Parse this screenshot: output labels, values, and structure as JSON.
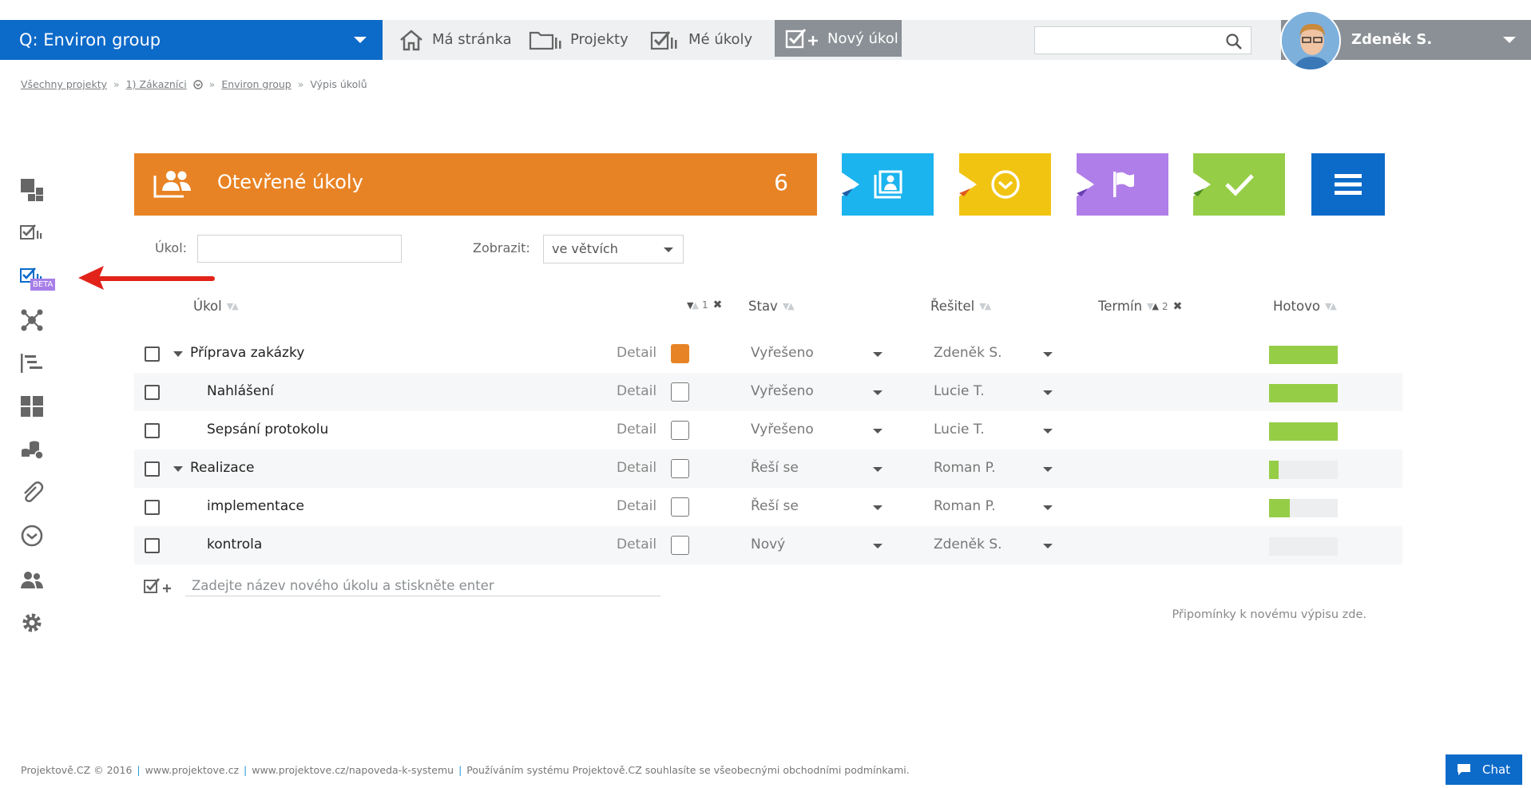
{
  "topbar": {
    "project_name": "Q: Environ group",
    "nav": {
      "my_page": "Má stránka",
      "projects": "Projekty",
      "my_tasks": "Mé úkoly",
      "new_task": "Nový úkol"
    },
    "search_placeholder": "",
    "user_name": "Zdeněk S."
  },
  "breadcrumb": {
    "items": [
      "Všechny projekty",
      "1) Zákazníci",
      "Environ group",
      "Výpis úkolů"
    ]
  },
  "sidebar": {
    "beta_label": "BETA",
    "icons": [
      "dashboard-icon",
      "tasks-icon",
      "tasks-beta-icon",
      "network-icon",
      "gantt-icon",
      "tiles-icon",
      "budget-icon",
      "attachment-icon",
      "clock-icon",
      "users-icon",
      "settings-icon"
    ]
  },
  "header": {
    "title": "Otevřené úkoly",
    "count": "6",
    "tiles": [
      {
        "name": "assigned-tile",
        "color": "#1cb4ee",
        "icon": "assign-icon"
      },
      {
        "name": "deadline-tile",
        "color": "#f1c412",
        "icon": "clock-icon"
      },
      {
        "name": "milestone-tile",
        "color": "#b07ee8",
        "icon": "flag-icon"
      },
      {
        "name": "done-tile",
        "color": "#96cd47",
        "icon": "check-icon"
      },
      {
        "name": "menu-tile",
        "color": "#0c6ac9",
        "icon": "hamburger-icon"
      }
    ]
  },
  "filters": {
    "task_label": "Úkol:",
    "task_value": "",
    "show_label": "Zobrazit:",
    "show_value": "ve větvích"
  },
  "table": {
    "headers": {
      "task": "Úkol",
      "priority_sort_index": "1",
      "status": "Stav",
      "assignee": "Řešitel",
      "deadline": "Termín",
      "deadline_sort_index": "2",
      "done": "Hotovo"
    },
    "detail_label": "Detail",
    "rows": [
      {
        "name": "Příprava zakázky",
        "level": 0,
        "expandable": true,
        "priority": true,
        "status": "Vyřešeno",
        "assignee": "Zdeněk S.",
        "progress": 100
      },
      {
        "name": "Nahlášení",
        "level": 1,
        "expandable": false,
        "priority": false,
        "status": "Vyřešeno",
        "assignee": "Lucie T.",
        "progress": 100
      },
      {
        "name": "Sepsání protokolu",
        "level": 1,
        "expandable": false,
        "priority": false,
        "status": "Vyřešeno",
        "assignee": "Lucie T.",
        "progress": 100
      },
      {
        "name": "Realizace",
        "level": 0,
        "expandable": true,
        "priority": false,
        "status": "Řeší se",
        "assignee": "Roman P.",
        "progress": 14
      },
      {
        "name": "implementace",
        "level": 1,
        "expandable": false,
        "priority": false,
        "status": "Řeší se",
        "assignee": "Roman P.",
        "progress": 30
      },
      {
        "name": "kontrola",
        "level": 1,
        "expandable": false,
        "priority": false,
        "status": "Nový",
        "assignee": "Zdeněk S.",
        "progress": 0
      }
    ],
    "new_task_placeholder": "Zadejte název nového úkolu a stiskněte enter"
  },
  "feedback_text": "Připomínky k novému výpisu zde.",
  "footer": {
    "copyright": "Projektově.CZ © 2016",
    "link1": "www.projektove.cz",
    "link2": "www.projektove.cz/napoveda-k-systemu",
    "terms": "Používáním systému Projektově.CZ souhlasíte se všeobecnými obchodními podmínkami."
  },
  "chat_label": "Chat",
  "colors": {
    "brand_blue": "#0c6ac9",
    "orange": "#e88325",
    "progress_green": "#96cd47"
  }
}
